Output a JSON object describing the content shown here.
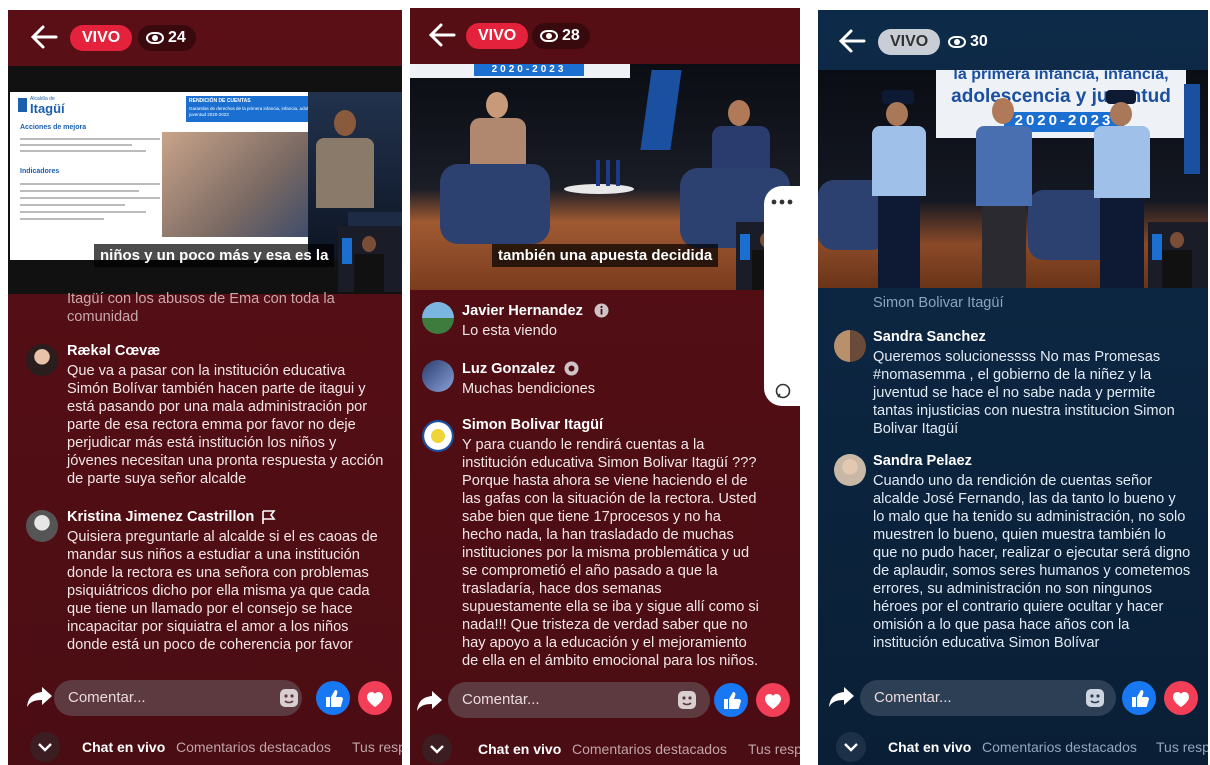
{
  "panels": [
    {
      "live_label": "VIVO",
      "viewers": "24",
      "caption": "niños y un poco más y esa es la",
      "slide": {
        "logo_small": "Alcaldía de",
        "logo": "Itagüí",
        "title": "RENDICIÓN DE CUENTAS",
        "subtitle": "Garantías de derechos de la primera infancia, infancia, adolescencia y juventud 2020-2023",
        "h1": "Acciones de mejora",
        "h2": "Indicadores"
      },
      "comments": [
        {
          "name": "",
          "text": "Itagüí con los abusos de Ema con toda la comunidad"
        },
        {
          "name": "Rækəl Cœvæ",
          "text": "Que va a pasar con la institución educativa Simón Bolívar también hacen parte de itagui y está pasando por una mala administración por parte de esa rectora emma por favor no deje perjudicar más está institución los niños y jóvenes necesitan una pronta respuesta y acción de parte suya señor alcalde"
        },
        {
          "name": "Kristina Jimenez Castrillon",
          "text": "Quisiera preguntarle al alcalde si el es caoas de mandar sus niños a estudiar a una institución donde la rectora es una señora con problemas psiquiátricos dicho por ella misma ya que cada que tiene un llamado por el consejo se hace incapacitar por siquiatra el amor a los niños donde está un poco de coherencia por favor"
        }
      ],
      "comment_placeholder": "Comentar...",
      "tabs": [
        "Chat en vivo",
        "Comentarios destacados",
        "Tus resp"
      ]
    },
    {
      "live_label": "VIVO",
      "viewers": "28",
      "caption": "también una apuesta decidida",
      "banner": "2020-2023",
      "comments": [
        {
          "name": "Javier Hernandez",
          "text": "Lo esta viendo"
        },
        {
          "name": "Luz Gonzalez",
          "text": "Muchas bendiciones"
        },
        {
          "name": "Simon Bolivar Itagüí",
          "text": "Y para cuando le rendirá cuentas a la institución educativa Simon Bolivar Itagüí ??? Porque hasta ahora se viene haciendo el de las gafas con la situación de la rectora. Usted sabe bien que tiene 17procesos y no ha hecho nada, la han trasladado de muchas instituciones por la misma problemática y ud se comprometió el año pasado a que la trasladaría, hace dos semanas supuestamente ella se iba y sigue allí como si nada!!! Que tristeza de verdad saber que no hay apoyo a la educación y el mejoramiento de ella en el ámbito emocional para los niños."
        }
      ],
      "comment_placeholder": "Comentar...",
      "tabs": [
        "Chat en vivo",
        "Comentarios destacados",
        "Tus resp"
      ]
    },
    {
      "live_label": "VIVO",
      "viewers": "30",
      "banner_line1": "la primera infancia, infancia,",
      "banner_line2": "adolescencia y juventud",
      "banner_line3": "2020-2023",
      "comments": [
        {
          "name": "",
          "text": "Simon Bolivar Itagüí"
        },
        {
          "name": "Sandra Sanchez",
          "text": "Queremos solucionessss No mas Promesas #nomasemma , el gobierno de la niñez y la juventud se hace el no sabe nada y permite tantas injusticias con nuestra institucion Simon Bolivar Itagüí"
        },
        {
          "name": "Sandra Pelaez",
          "text": "Cuando uno da rendición de cuentas señor alcalde José Fernando, las da tanto lo bueno y lo malo que ha tenido su administración, no solo muestren lo bueno, quien muestra también lo que no pudo hacer, realizar o ejecutar será digno de aplaudir, somos seres humanos y cometemos errores, su administración no son ningunos héroes por el contrario quiere ocultar y hacer omisión a lo que pasa hace años con la institución educativa Simon Bolívar"
        }
      ],
      "comment_placeholder": "Comentar...",
      "tabs": [
        "Chat en vivo",
        "Comentarios destacados",
        "Tus resp"
      ]
    }
  ]
}
